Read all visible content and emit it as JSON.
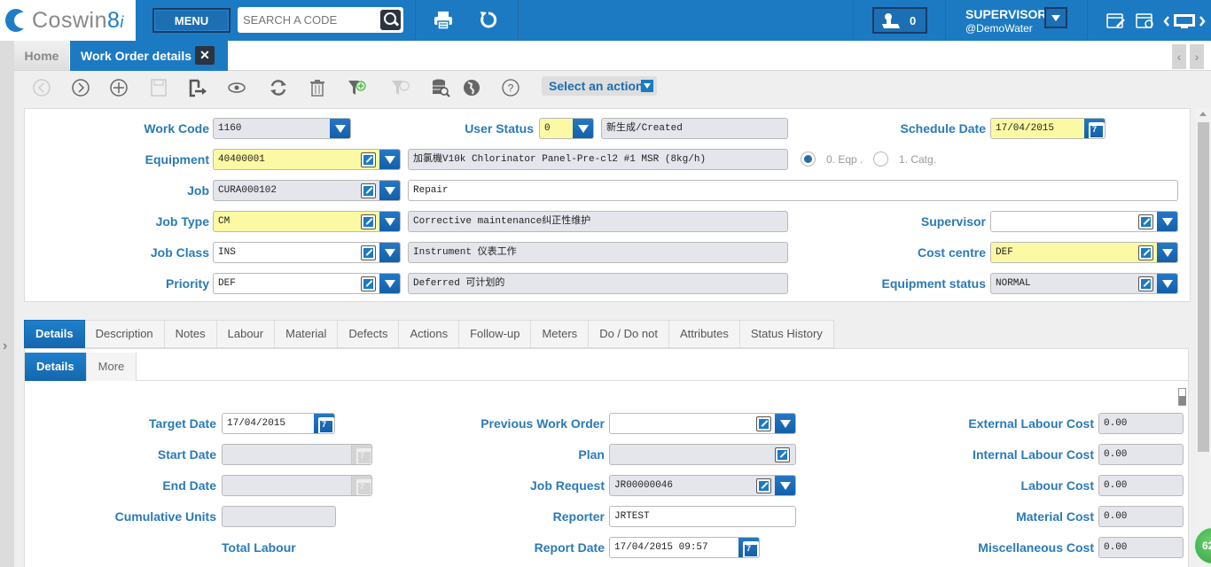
{
  "app": {
    "logo_text": "Coswin",
    "logo_version": "8",
    "logo_suffix": "i"
  },
  "topbar": {
    "menu_label": "MENU",
    "search_placeholder": "SEARCH A CODE",
    "notification_count": "0",
    "user_name": "SUPERVISOR",
    "user_org": "@DemoWater"
  },
  "tabs_strip": {
    "home_label": "Home",
    "active_tab_label": "Work Order details",
    "close_symbol": "✕",
    "prev_symbol": "‹",
    "next_symbol": "›"
  },
  "toolbar": {
    "action_select_label": "Select an action",
    "tools": [
      "previous-icon",
      "next-icon",
      "add-icon",
      "save-icon",
      "export-icon",
      "view-icon",
      "sync-icon",
      "delete-icon",
      "filter-add-icon",
      "filter-remove-icon",
      "database-search-icon",
      "globe-icon",
      "help-icon"
    ]
  },
  "header": {
    "work_code": {
      "label": "Work Code",
      "value": "1160"
    },
    "user_status": {
      "label": "User Status",
      "value": "0",
      "description": "新生成/Created"
    },
    "schedule_date": {
      "label": "Schedule Date",
      "value": "17/04/2015"
    },
    "equipment": {
      "label": "Equipment",
      "value": "40400001",
      "description": "加氯機V10k Chlorinator Panel-Pre-cl2 #1 MSR (8kg/h)"
    },
    "equipment_mode": {
      "option_0": "0. Eqp .",
      "option_1": "1. Catg.",
      "selected": "0. Eqp ."
    },
    "job": {
      "label": "Job",
      "value": "CURA000102",
      "description": "Repair"
    },
    "job_type": {
      "label": "Job Type",
      "value": "CM",
      "description": "Corrective maintenance纠正性维护"
    },
    "job_class": {
      "label": "Job Class",
      "value": "INS",
      "description": "Instrument 仪表工作"
    },
    "priority": {
      "label": "Priority",
      "value": "DEF",
      "description": "Deferred 可计划的"
    },
    "supervisor": {
      "label": "Supervisor",
      "value": ""
    },
    "cost_centre": {
      "label": "Cost centre",
      "value": "DEF"
    },
    "equipment_status": {
      "label": "Equipment status",
      "value": "NORMAL"
    }
  },
  "main_tabs": [
    {
      "label": "Details",
      "active": true
    },
    {
      "label": "Description"
    },
    {
      "label": "Notes"
    },
    {
      "label": "Labour"
    },
    {
      "label": "Material"
    },
    {
      "label": "Defects"
    },
    {
      "label": "Actions"
    },
    {
      "label": "Follow-up"
    },
    {
      "label": "Meters"
    },
    {
      "label": "Do / Do not"
    },
    {
      "label": "Attributes"
    },
    {
      "label": "Status History"
    }
  ],
  "sub_tabs": [
    {
      "label": "Details",
      "active": true
    },
    {
      "label": "More"
    }
  ],
  "details": {
    "target_date": {
      "label": "Target Date",
      "value": "17/04/2015"
    },
    "start_date": {
      "label": "Start Date",
      "value": ""
    },
    "end_date": {
      "label": "End Date",
      "value": ""
    },
    "cumulative_units": {
      "label": "Cumulative Units",
      "value": ""
    },
    "total_labour": {
      "label": "Total Labour"
    },
    "previous_work_order": {
      "label": "Previous Work Order",
      "value": ""
    },
    "plan": {
      "label": "Plan",
      "value": ""
    },
    "job_request": {
      "label": "Job Request",
      "value": "JR00000046"
    },
    "reporter": {
      "label": "Reporter",
      "value": "JRTEST"
    },
    "report_date": {
      "label": "Report Date",
      "value": "17/04/2015 09:57"
    },
    "external_labour_cost": {
      "label": "External Labour Cost",
      "value": "0.00"
    },
    "internal_labour_cost": {
      "label": "Internal Labour Cost",
      "value": "0.00"
    },
    "labour_cost": {
      "label": "Labour Cost",
      "value": "0.00"
    },
    "material_cost": {
      "label": "Material Cost",
      "value": "0.00"
    },
    "miscellaneous_cost": {
      "label": "Miscellaneous Cost",
      "value": "0.00"
    }
  },
  "fab": {
    "label": "62"
  },
  "left_rail": {
    "expand_symbol": "›"
  }
}
